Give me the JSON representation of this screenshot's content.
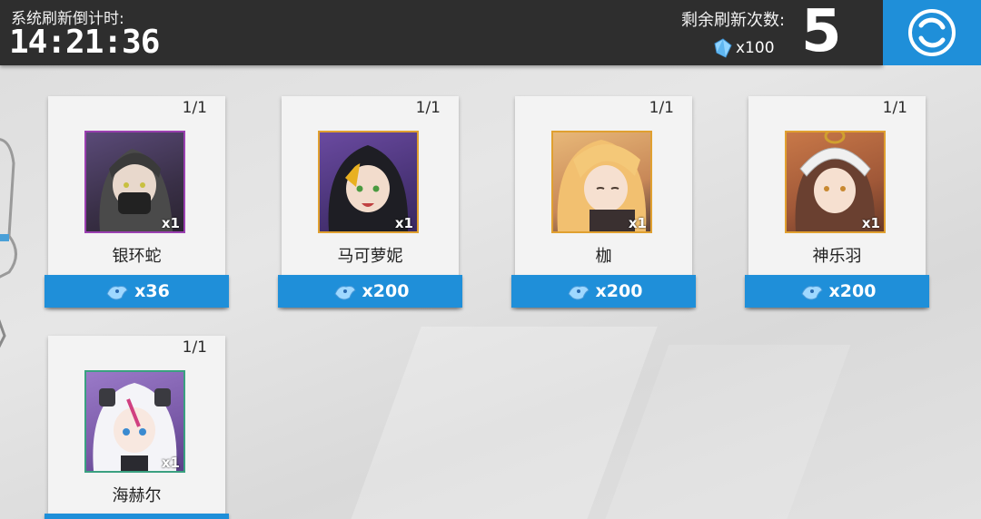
{
  "header": {
    "timer_label": "系统刷新倒计时:",
    "timer_value": "14:21:36",
    "refresh_label": "剩余刷新次数:",
    "refresh_count": "5",
    "refresh_cost": "x100"
  },
  "colors": {
    "accent": "#1f8fd9",
    "header_bg": "#2e2e2e"
  },
  "items": [
    {
      "name": "银环蛇",
      "stock": "1/1",
      "qty": "x1",
      "price": "x36",
      "frame": "#9a3fb0"
    },
    {
      "name": "马可萝妮",
      "stock": "1/1",
      "qty": "x1",
      "price": "x200",
      "frame": "#e0a030"
    },
    {
      "name": "枷",
      "stock": "1/1",
      "qty": "x1",
      "price": "x200",
      "frame": "#e0a030"
    },
    {
      "name": "神乐羽",
      "stock": "1/1",
      "qty": "x1",
      "price": "x200",
      "frame": "#e0a030"
    },
    {
      "name": "海赫尔",
      "stock": "1/1",
      "qty": "x1",
      "price": "",
      "frame": "#3aa080"
    }
  ],
  "icons": {
    "currency": "blue-crystal-icon",
    "buy_currency": "blue-spirit-icon",
    "refresh": "refresh-cycle-icon"
  }
}
